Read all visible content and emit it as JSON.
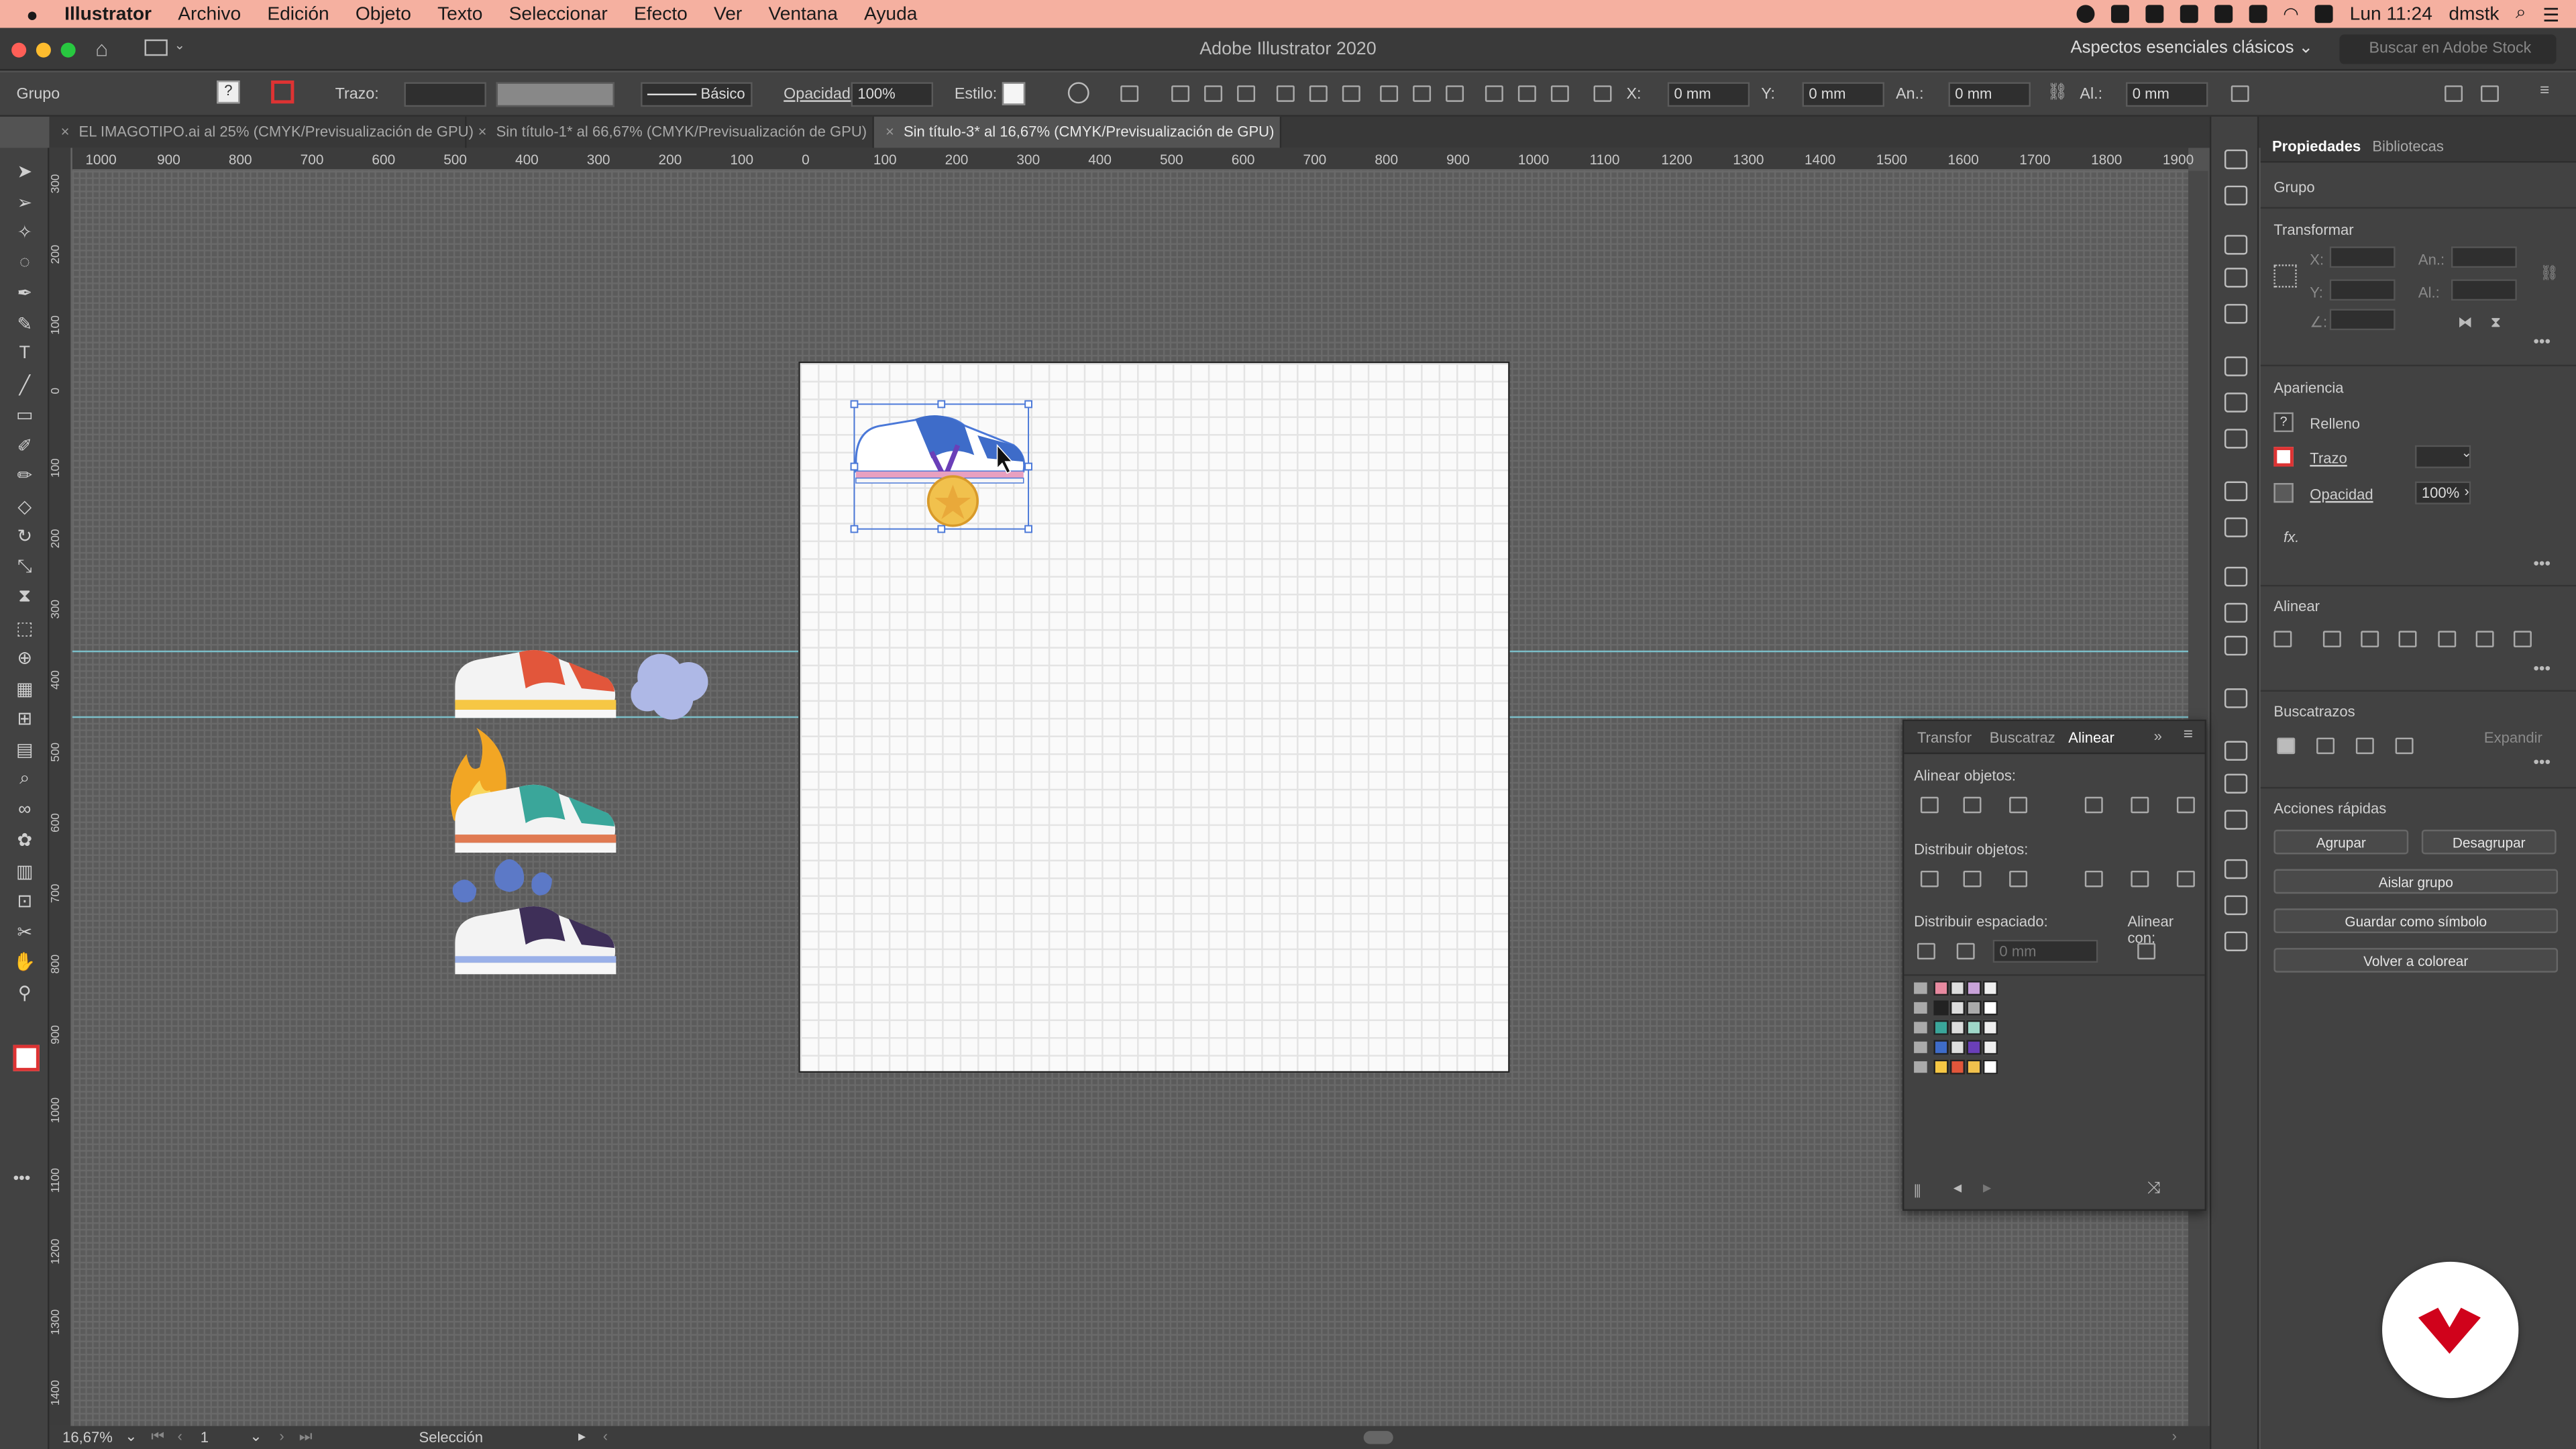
{
  "menubar": {
    "app_name": "Illustrator",
    "items": [
      "Archivo",
      "Edición",
      "Objeto",
      "Texto",
      "Seleccionar",
      "Efecto",
      "Ver",
      "Ventana",
      "Ayuda"
    ],
    "clock": "Lun 11:24",
    "user": "dmstk"
  },
  "window": {
    "title": "Adobe Illustrator 2020",
    "workspace": "Aspectos esenciales clásicos",
    "stock_search_placeholder": "Buscar en Adobe Stock"
  },
  "control_bar": {
    "selection_type": "Grupo",
    "stroke_label": "Trazo:",
    "brush_label": "Básico",
    "opacity_label": "Opacidad:",
    "opacity_value": "100%",
    "style_label": "Estilo:",
    "x_label": "X:",
    "x_value": "0 mm",
    "y_label": "Y:",
    "y_value": "0 mm",
    "width_label": "An.:",
    "width_value": "0 mm",
    "height_label": "Al.:",
    "height_value": "0 mm"
  },
  "tabs": [
    {
      "label": "EL IMAGOTIPO.ai al 25% (CMYK/Previsualización de GPU)",
      "active": false
    },
    {
      "label": "Sin título-1* al 66,67% (CMYK/Previsualización de GPU)",
      "active": false
    },
    {
      "label": "Sin título-3* al 16,67% (CMYK/Previsualización de GPU)",
      "active": true
    }
  ],
  "rulers": {
    "horizontal": [
      "1000",
      "900",
      "800",
      "700",
      "600",
      "500",
      "400",
      "300",
      "200",
      "100",
      "0",
      "100",
      "200",
      "300",
      "400",
      "500",
      "600",
      "700",
      "800",
      "900",
      "1000",
      "1100",
      "1200",
      "1300",
      "1400",
      "1500",
      "1600",
      "1700",
      "1800",
      "1900"
    ],
    "vertical": [
      "300",
      "200",
      "100",
      "0",
      "100",
      "200",
      "300",
      "400",
      "500",
      "600",
      "700",
      "800",
      "900",
      "1000",
      "1100",
      "1200",
      "1300",
      "1400"
    ]
  },
  "status_bar": {
    "zoom": "16,67%",
    "artboard_number": "1",
    "tool": "Selección"
  },
  "properties_panel": {
    "tabs": [
      "Propiedades",
      "Bibliotecas"
    ],
    "selection_type": "Grupo",
    "transform_title": "Transformar",
    "transform_x_label": "X:",
    "transform_y_label": "Y:",
    "transform_w_label": "An.:",
    "transform_h_label": "Al.:",
    "transform_angle_label": "∠:",
    "appearance_title": "Apariencia",
    "fill_label": "Relleno",
    "stroke_label": "Trazo",
    "opacity_label": "Opacidad",
    "opacity_value": "100%",
    "fx_label": "fx.",
    "align_title": "Alinear",
    "pathfinder_title": "Buscatrazos",
    "expand_label": "Expandir",
    "quick_actions_title": "Acciones rápidas",
    "group_btn": "Agrupar",
    "ungroup_btn": "Desagrupar",
    "isolate_btn": "Aislar grupo",
    "save_symbol_btn": "Guardar como símbolo",
    "recolor_btn": "Volver a colorear"
  },
  "floating_panel": {
    "tabs": [
      "Transfor",
      "Buscatraz",
      "Alinear"
    ],
    "active_tab": "Alinear",
    "align_objects_label": "Alinear objetos:",
    "distribute_objects_label": "Distribuir objetos:",
    "distribute_spacing_label": "Distribuir espaciado:",
    "align_to_label": "Alinear con:",
    "spacing_value": "0 mm"
  },
  "colors": {
    "menubar_bg": "#f5b0a0",
    "panel_bg": "#424242",
    "canvas_bg": "#5b5b5b",
    "artboard_bg": "#fafafa",
    "guide_color": "#7fd3e0",
    "selection_color": "#4a78d8",
    "logo_red": "#d0021b"
  },
  "icons": {
    "apple": "apple-icon",
    "home": "home-icon",
    "search": "search-icon",
    "logo": "brand-logo"
  }
}
